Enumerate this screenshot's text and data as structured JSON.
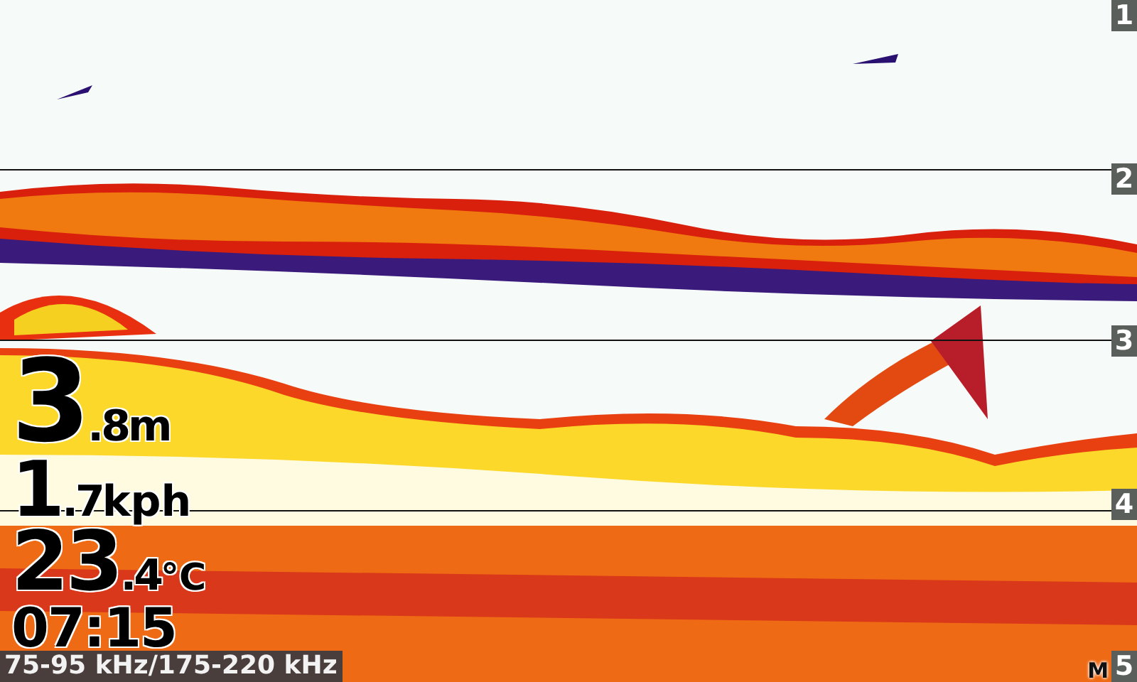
{
  "depth_scale": {
    "unit": "M",
    "marks": [
      "1",
      "2",
      "3",
      "4",
      "5"
    ]
  },
  "readouts": [
    {
      "kind": "depth",
      "whole": "3",
      "fraction": ".8",
      "unit": "m"
    },
    {
      "kind": "speed",
      "whole": "1",
      "fraction": ".7",
      "unit": "kph"
    },
    {
      "kind": "temperature",
      "whole": "23",
      "fraction": ".4",
      "unit": "°C"
    },
    {
      "kind": "time",
      "text": "07:15"
    }
  ],
  "frequency": "75-95 kHz/175-220 kHz"
}
